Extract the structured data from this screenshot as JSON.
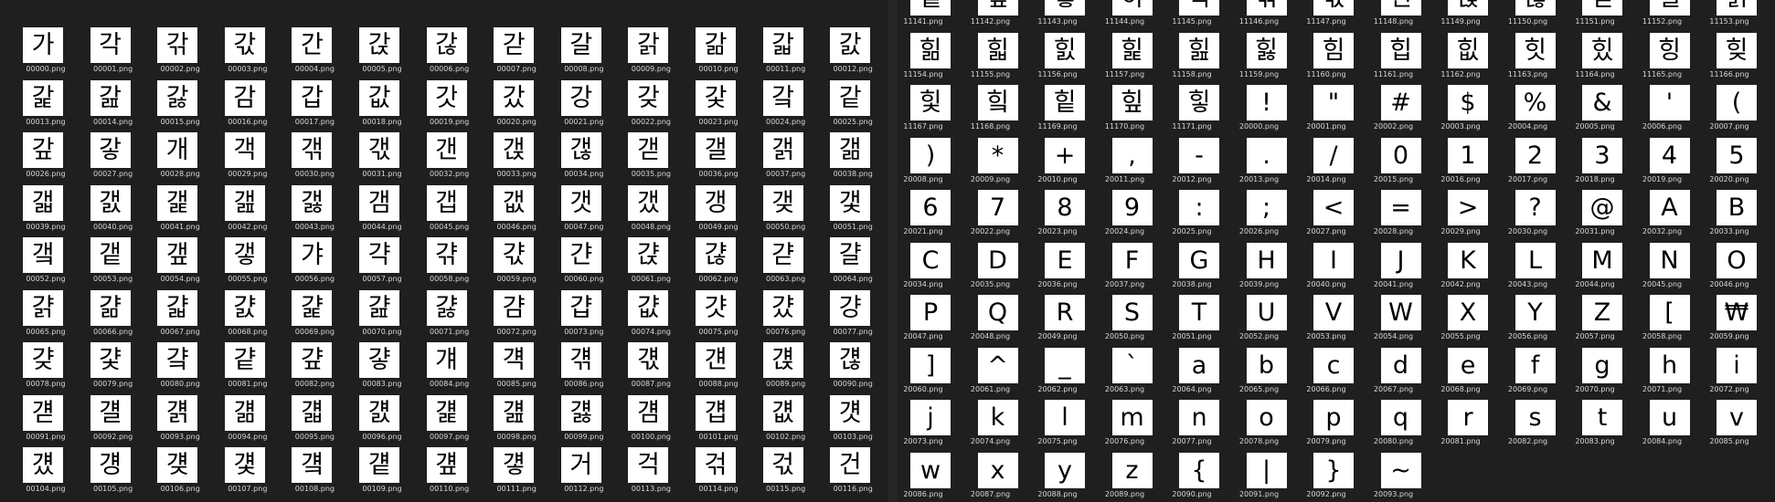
{
  "colors": {
    "background": "#1f1f1f",
    "tile": "#ffffff",
    "caption": "#d8d8d8"
  },
  "left_pane": {
    "tiles": [
      {
        "glyph": "가",
        "file": "00000.png"
      },
      {
        "glyph": "각",
        "file": "00001.png"
      },
      {
        "glyph": "갂",
        "file": "00002.png"
      },
      {
        "glyph": "갃",
        "file": "00003.png"
      },
      {
        "glyph": "간",
        "file": "00004.png"
      },
      {
        "glyph": "갅",
        "file": "00005.png"
      },
      {
        "glyph": "갆",
        "file": "00006.png"
      },
      {
        "glyph": "갇",
        "file": "00007.png"
      },
      {
        "glyph": "갈",
        "file": "00008.png"
      },
      {
        "glyph": "갉",
        "file": "00009.png"
      },
      {
        "glyph": "갊",
        "file": "00010.png"
      },
      {
        "glyph": "갋",
        "file": "00011.png"
      },
      {
        "glyph": "갌",
        "file": "00012.png"
      },
      {
        "glyph": "갍",
        "file": "00013.png"
      },
      {
        "glyph": "갎",
        "file": "00014.png"
      },
      {
        "glyph": "갏",
        "file": "00015.png"
      },
      {
        "glyph": "감",
        "file": "00016.png"
      },
      {
        "glyph": "갑",
        "file": "00017.png"
      },
      {
        "glyph": "값",
        "file": "00018.png"
      },
      {
        "glyph": "갓",
        "file": "00019.png"
      },
      {
        "glyph": "갔",
        "file": "00020.png"
      },
      {
        "glyph": "강",
        "file": "00021.png"
      },
      {
        "glyph": "갖",
        "file": "00022.png"
      },
      {
        "glyph": "갗",
        "file": "00023.png"
      },
      {
        "glyph": "갘",
        "file": "00024.png"
      },
      {
        "glyph": "같",
        "file": "00025.png"
      },
      {
        "glyph": "갚",
        "file": "00026.png"
      },
      {
        "glyph": "갛",
        "file": "00027.png"
      },
      {
        "glyph": "개",
        "file": "00028.png"
      },
      {
        "glyph": "객",
        "file": "00029.png"
      },
      {
        "glyph": "갞",
        "file": "00030.png"
      },
      {
        "glyph": "갟",
        "file": "00031.png"
      },
      {
        "glyph": "갠",
        "file": "00032.png"
      },
      {
        "glyph": "갡",
        "file": "00033.png"
      },
      {
        "glyph": "갢",
        "file": "00034.png"
      },
      {
        "glyph": "갣",
        "file": "00035.png"
      },
      {
        "glyph": "갤",
        "file": "00036.png"
      },
      {
        "glyph": "갥",
        "file": "00037.png"
      },
      {
        "glyph": "갦",
        "file": "00038.png"
      },
      {
        "glyph": "갧",
        "file": "00039.png"
      },
      {
        "glyph": "갨",
        "file": "00040.png"
      },
      {
        "glyph": "갩",
        "file": "00041.png"
      },
      {
        "glyph": "갪",
        "file": "00042.png"
      },
      {
        "glyph": "갫",
        "file": "00043.png"
      },
      {
        "glyph": "갬",
        "file": "00044.png"
      },
      {
        "glyph": "갭",
        "file": "00045.png"
      },
      {
        "glyph": "갮",
        "file": "00046.png"
      },
      {
        "glyph": "갯",
        "file": "00047.png"
      },
      {
        "glyph": "갰",
        "file": "00048.png"
      },
      {
        "glyph": "갱",
        "file": "00049.png"
      },
      {
        "glyph": "갲",
        "file": "00050.png"
      },
      {
        "glyph": "갳",
        "file": "00051.png"
      },
      {
        "glyph": "갴",
        "file": "00052.png"
      },
      {
        "glyph": "갵",
        "file": "00053.png"
      },
      {
        "glyph": "갶",
        "file": "00054.png"
      },
      {
        "glyph": "갷",
        "file": "00055.png"
      },
      {
        "glyph": "갸",
        "file": "00056.png"
      },
      {
        "glyph": "갹",
        "file": "00057.png"
      },
      {
        "glyph": "갺",
        "file": "00058.png"
      },
      {
        "glyph": "갻",
        "file": "00059.png"
      },
      {
        "glyph": "갼",
        "file": "00060.png"
      },
      {
        "glyph": "갽",
        "file": "00061.png"
      },
      {
        "glyph": "갾",
        "file": "00062.png"
      },
      {
        "glyph": "갿",
        "file": "00063.png"
      },
      {
        "glyph": "걀",
        "file": "00064.png"
      },
      {
        "glyph": "걁",
        "file": "00065.png"
      },
      {
        "glyph": "걂",
        "file": "00066.png"
      },
      {
        "glyph": "걃",
        "file": "00067.png"
      },
      {
        "glyph": "걄",
        "file": "00068.png"
      },
      {
        "glyph": "걅",
        "file": "00069.png"
      },
      {
        "glyph": "걆",
        "file": "00070.png"
      },
      {
        "glyph": "걇",
        "file": "00071.png"
      },
      {
        "glyph": "걈",
        "file": "00072.png"
      },
      {
        "glyph": "걉",
        "file": "00073.png"
      },
      {
        "glyph": "걊",
        "file": "00074.png"
      },
      {
        "glyph": "걋",
        "file": "00075.png"
      },
      {
        "glyph": "걌",
        "file": "00076.png"
      },
      {
        "glyph": "걍",
        "file": "00077.png"
      },
      {
        "glyph": "걎",
        "file": "00078.png"
      },
      {
        "glyph": "걏",
        "file": "00079.png"
      },
      {
        "glyph": "걐",
        "file": "00080.png"
      },
      {
        "glyph": "걑",
        "file": "00081.png"
      },
      {
        "glyph": "걒",
        "file": "00082.png"
      },
      {
        "glyph": "걓",
        "file": "00083.png"
      },
      {
        "glyph": "걔",
        "file": "00084.png"
      },
      {
        "glyph": "걕",
        "file": "00085.png"
      },
      {
        "glyph": "걖",
        "file": "00086.png"
      },
      {
        "glyph": "걗",
        "file": "00087.png"
      },
      {
        "glyph": "걘",
        "file": "00088.png"
      },
      {
        "glyph": "걙",
        "file": "00089.png"
      },
      {
        "glyph": "걚",
        "file": "00090.png"
      },
      {
        "glyph": "걛",
        "file": "00091.png"
      },
      {
        "glyph": "걜",
        "file": "00092.png"
      },
      {
        "glyph": "걝",
        "file": "00093.png"
      },
      {
        "glyph": "걞",
        "file": "00094.png"
      },
      {
        "glyph": "걟",
        "file": "00095.png"
      },
      {
        "glyph": "걠",
        "file": "00096.png"
      },
      {
        "glyph": "걡",
        "file": "00097.png"
      },
      {
        "glyph": "걢",
        "file": "00098.png"
      },
      {
        "glyph": "걣",
        "file": "00099.png"
      },
      {
        "glyph": "걤",
        "file": "00100.png"
      },
      {
        "glyph": "걥",
        "file": "00101.png"
      },
      {
        "glyph": "걦",
        "file": "00102.png"
      },
      {
        "glyph": "걧",
        "file": "00103.png"
      },
      {
        "glyph": "걨",
        "file": "00104.png"
      },
      {
        "glyph": "걩",
        "file": "00105.png"
      },
      {
        "glyph": "걪",
        "file": "00106.png"
      },
      {
        "glyph": "걫",
        "file": "00107.png"
      },
      {
        "glyph": "걬",
        "file": "00108.png"
      },
      {
        "glyph": "걭",
        "file": "00109.png"
      },
      {
        "glyph": "걮",
        "file": "00110.png"
      },
      {
        "glyph": "걯",
        "file": "00111.png"
      },
      {
        "glyph": "거",
        "file": "00112.png"
      },
      {
        "glyph": "걱",
        "file": "00113.png"
      },
      {
        "glyph": "걲",
        "file": "00114.png"
      },
      {
        "glyph": "걳",
        "file": "00115.png"
      },
      {
        "glyph": "건",
        "file": "00116.png"
      }
    ]
  },
  "right_pane": {
    "tiles": [
      {
        "glyph": "힅",
        "file": "11141.png"
      },
      {
        "glyph": "힆",
        "file": "11142.png"
      },
      {
        "glyph": "힇",
        "file": "11143.png"
      },
      {
        "glyph": "히",
        "file": "11144.png"
      },
      {
        "glyph": "힉",
        "file": "11145.png"
      },
      {
        "glyph": "힊",
        "file": "11146.png"
      },
      {
        "glyph": "힋",
        "file": "11147.png"
      },
      {
        "glyph": "힌",
        "file": "11148.png"
      },
      {
        "glyph": "힍",
        "file": "11149.png"
      },
      {
        "glyph": "힎",
        "file": "11150.png"
      },
      {
        "glyph": "힏",
        "file": "11151.png"
      },
      {
        "glyph": "힐",
        "file": "11152.png"
      },
      {
        "glyph": "힑",
        "file": "11153.png"
      },
      {
        "glyph": "힒",
        "file": "11154.png"
      },
      {
        "glyph": "힓",
        "file": "11155.png"
      },
      {
        "glyph": "힔",
        "file": "11156.png"
      },
      {
        "glyph": "힕",
        "file": "11157.png"
      },
      {
        "glyph": "힖",
        "file": "11158.png"
      },
      {
        "glyph": "힗",
        "file": "11159.png"
      },
      {
        "glyph": "힘",
        "file": "11160.png"
      },
      {
        "glyph": "힙",
        "file": "11161.png"
      },
      {
        "glyph": "힚",
        "file": "11162.png"
      },
      {
        "glyph": "힛",
        "file": "11163.png"
      },
      {
        "glyph": "힜",
        "file": "11164.png"
      },
      {
        "glyph": "힝",
        "file": "11165.png"
      },
      {
        "glyph": "힞",
        "file": "11166.png"
      },
      {
        "glyph": "힟",
        "file": "11167.png"
      },
      {
        "glyph": "힠",
        "file": "11168.png"
      },
      {
        "glyph": "힡",
        "file": "11169.png"
      },
      {
        "glyph": "힢",
        "file": "11170.png"
      },
      {
        "glyph": "힣",
        "file": "11171.png"
      },
      {
        "glyph": "!",
        "file": "20000.png"
      },
      {
        "glyph": "\"",
        "file": "20001.png"
      },
      {
        "glyph": "#",
        "file": "20002.png"
      },
      {
        "glyph": "$",
        "file": "20003.png"
      },
      {
        "glyph": "%",
        "file": "20004.png"
      },
      {
        "glyph": "&",
        "file": "20005.png"
      },
      {
        "glyph": "'",
        "file": "20006.png"
      },
      {
        "glyph": "(",
        "file": "20007.png"
      },
      {
        "glyph": ")",
        "file": "20008.png"
      },
      {
        "glyph": "*",
        "file": "20009.png"
      },
      {
        "glyph": "+",
        "file": "20010.png"
      },
      {
        "glyph": ",",
        "file": "20011.png"
      },
      {
        "glyph": "-",
        "file": "20012.png"
      },
      {
        "glyph": ".",
        "file": "20013.png"
      },
      {
        "glyph": "/",
        "file": "20014.png"
      },
      {
        "glyph": "0",
        "file": "20015.png"
      },
      {
        "glyph": "1",
        "file": "20016.png"
      },
      {
        "glyph": "2",
        "file": "20017.png"
      },
      {
        "glyph": "3",
        "file": "20018.png"
      },
      {
        "glyph": "4",
        "file": "20019.png"
      },
      {
        "glyph": "5",
        "file": "20020.png"
      },
      {
        "glyph": "6",
        "file": "20021.png"
      },
      {
        "glyph": "7",
        "file": "20022.png"
      },
      {
        "glyph": "8",
        "file": "20023.png"
      },
      {
        "glyph": "9",
        "file": "20024.png"
      },
      {
        "glyph": ":",
        "file": "20025.png"
      },
      {
        "glyph": ";",
        "file": "20026.png"
      },
      {
        "glyph": "<",
        "file": "20027.png"
      },
      {
        "glyph": "=",
        "file": "20028.png"
      },
      {
        "glyph": ">",
        "file": "20029.png"
      },
      {
        "glyph": "?",
        "file": "20030.png"
      },
      {
        "glyph": "@",
        "file": "20031.png"
      },
      {
        "glyph": "A",
        "file": "20032.png"
      },
      {
        "glyph": "B",
        "file": "20033.png"
      },
      {
        "glyph": "C",
        "file": "20034.png"
      },
      {
        "glyph": "D",
        "file": "20035.png"
      },
      {
        "glyph": "E",
        "file": "20036.png"
      },
      {
        "glyph": "F",
        "file": "20037.png"
      },
      {
        "glyph": "G",
        "file": "20038.png"
      },
      {
        "glyph": "H",
        "file": "20039.png"
      },
      {
        "glyph": "I",
        "file": "20040.png"
      },
      {
        "glyph": "J",
        "file": "20041.png"
      },
      {
        "glyph": "K",
        "file": "20042.png"
      },
      {
        "glyph": "L",
        "file": "20043.png"
      },
      {
        "glyph": "M",
        "file": "20044.png"
      },
      {
        "glyph": "N",
        "file": "20045.png"
      },
      {
        "glyph": "O",
        "file": "20046.png"
      },
      {
        "glyph": "P",
        "file": "20047.png"
      },
      {
        "glyph": "Q",
        "file": "20048.png"
      },
      {
        "glyph": "R",
        "file": "20049.png"
      },
      {
        "glyph": "S",
        "file": "20050.png"
      },
      {
        "glyph": "T",
        "file": "20051.png"
      },
      {
        "glyph": "U",
        "file": "20052.png"
      },
      {
        "glyph": "V",
        "file": "20053.png"
      },
      {
        "glyph": "W",
        "file": "20054.png"
      },
      {
        "glyph": "X",
        "file": "20055.png"
      },
      {
        "glyph": "Y",
        "file": "20056.png"
      },
      {
        "glyph": "Z",
        "file": "20057.png"
      },
      {
        "glyph": "[",
        "file": "20058.png"
      },
      {
        "glyph": "₩",
        "file": "20059.png"
      },
      {
        "glyph": "]",
        "file": "20060.png"
      },
      {
        "glyph": "^",
        "file": "20061.png"
      },
      {
        "glyph": "_",
        "file": "20062.png"
      },
      {
        "glyph": "`",
        "file": "20063.png"
      },
      {
        "glyph": "a",
        "file": "20064.png"
      },
      {
        "glyph": "b",
        "file": "20065.png"
      },
      {
        "glyph": "c",
        "file": "20066.png"
      },
      {
        "glyph": "d",
        "file": "20067.png"
      },
      {
        "glyph": "e",
        "file": "20068.png"
      },
      {
        "glyph": "f",
        "file": "20069.png"
      },
      {
        "glyph": "g",
        "file": "20070.png"
      },
      {
        "glyph": "h",
        "file": "20071.png"
      },
      {
        "glyph": "i",
        "file": "20072.png"
      },
      {
        "glyph": "j",
        "file": "20073.png"
      },
      {
        "glyph": "k",
        "file": "20074.png"
      },
      {
        "glyph": "l",
        "file": "20075.png"
      },
      {
        "glyph": "m",
        "file": "20076.png"
      },
      {
        "glyph": "n",
        "file": "20077.png"
      },
      {
        "glyph": "o",
        "file": "20078.png"
      },
      {
        "glyph": "p",
        "file": "20079.png"
      },
      {
        "glyph": "q",
        "file": "20080.png"
      },
      {
        "glyph": "r",
        "file": "20081.png"
      },
      {
        "glyph": "s",
        "file": "20082.png"
      },
      {
        "glyph": "t",
        "file": "20083.png"
      },
      {
        "glyph": "u",
        "file": "20084.png"
      },
      {
        "glyph": "v",
        "file": "20085.png"
      },
      {
        "glyph": "w",
        "file": "20086.png"
      },
      {
        "glyph": "x",
        "file": "20087.png"
      },
      {
        "glyph": "y",
        "file": "20088.png"
      },
      {
        "glyph": "z",
        "file": "20089.png"
      },
      {
        "glyph": "{",
        "file": "20090.png"
      },
      {
        "glyph": "|",
        "file": "20091.png"
      },
      {
        "glyph": "}",
        "file": "20092.png"
      },
      {
        "glyph": "~",
        "file": "20093.png"
      }
    ]
  }
}
